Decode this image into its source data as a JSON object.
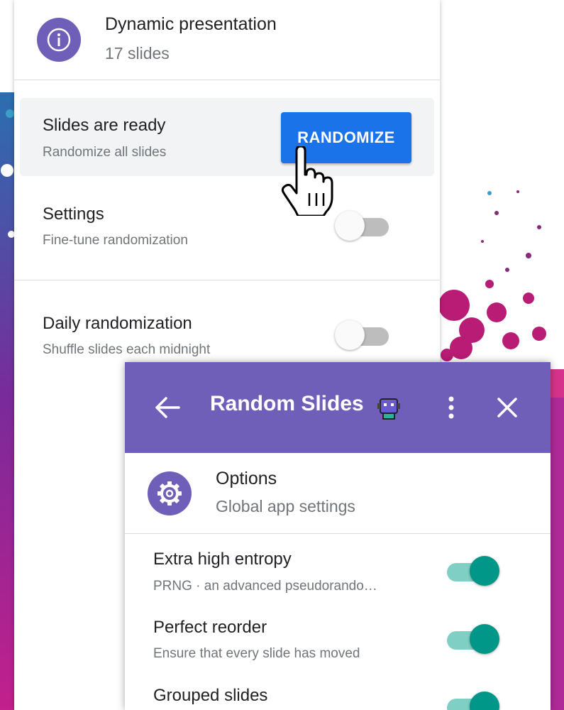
{
  "colors": {
    "accent_purple": "#6f5fb8",
    "button_blue": "#1a73e8",
    "toggle_teal": "#009688"
  },
  "back_panel": {
    "header": {
      "icon": "info-icon",
      "title": "Dynamic presentation",
      "subtitle": "17 slides"
    },
    "ready_row": {
      "title": "Slides are ready",
      "subtitle": "Randomize all slides",
      "button_label": "RANDOMIZE"
    },
    "settings_row": {
      "title": "Settings",
      "subtitle": "Fine-tune randomization",
      "toggle_on": false
    },
    "daily_row": {
      "title": "Daily randomization",
      "subtitle": "Shuffle slides each midnight",
      "toggle_on": false
    }
  },
  "front_panel": {
    "appbar": {
      "back_icon": "arrow-left-icon",
      "title": "Random Slides",
      "mascot_icon": "robot-mascot-icon",
      "more_icon": "more-vert-icon",
      "close_icon": "close-icon"
    },
    "options": {
      "icon": "gear-icon",
      "title": "Options",
      "subtitle": "Global app settings"
    },
    "items": [
      {
        "title": "Extra high entropy",
        "subtitle": "PRNG · an advanced pseudorando…",
        "toggle_on": true
      },
      {
        "title": "Perfect reorder",
        "subtitle": "Ensure that every slide has moved",
        "toggle_on": true
      },
      {
        "title": "Grouped slides",
        "subtitle": "",
        "toggle_on": true
      }
    ]
  }
}
